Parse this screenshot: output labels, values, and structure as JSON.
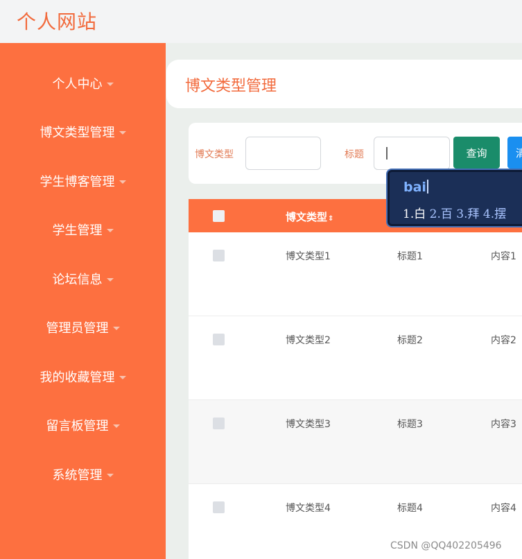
{
  "site": {
    "title": "个人网站"
  },
  "sidebar": {
    "items": [
      {
        "label": "个人中心"
      },
      {
        "label": "博文类型管理"
      },
      {
        "label": "学生博客管理"
      },
      {
        "label": "学生管理"
      },
      {
        "label": "论坛信息"
      },
      {
        "label": "管理员管理"
      },
      {
        "label": "我的收藏管理"
      },
      {
        "label": "留言板管理"
      },
      {
        "label": "系统管理"
      }
    ]
  },
  "breadcrumb": {
    "title": "博文类型管理"
  },
  "filter": {
    "type_label": "博文类型",
    "type_value": "",
    "title_label": "标题",
    "title_value": "",
    "search_button": "查询",
    "second_button": "清"
  },
  "table": {
    "header_type": "博文类型",
    "rows": [
      {
        "type": "博文类型1",
        "title": "标题1",
        "content": "内容1"
      },
      {
        "type": "博文类型2",
        "title": "标题2",
        "content": "内容2"
      },
      {
        "type": "博文类型3",
        "title": "标题3",
        "content": "内容3"
      },
      {
        "type": "博文类型4",
        "title": "标题4",
        "content": "内容4"
      }
    ]
  },
  "ime": {
    "input": "bai",
    "candidates": [
      "1.白",
      "2.百",
      "3.拜",
      "4.摆"
    ]
  },
  "watermark": "CSDN @QQ402205496",
  "colors": {
    "accent": "#fd7040",
    "title_orange": "#f26a3c",
    "search_green": "#1a8c6a",
    "button_blue": "#1a8ff0"
  }
}
